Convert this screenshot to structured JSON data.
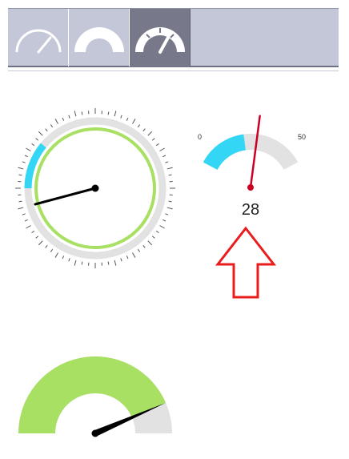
{
  "toolbar": {
    "tabs": [
      {
        "icon": "gauge-outline-icon",
        "selected": false
      },
      {
        "icon": "gauge-semicircle-icon",
        "selected": false
      },
      {
        "icon": "gauge-tachometer-icon",
        "selected": true
      }
    ]
  },
  "colors": {
    "accent_blue": "#33d7f5",
    "progress_green": "#a8e063",
    "track_gray": "#e2e2e2",
    "needle_black": "#000000",
    "needle_red": "#cc0022",
    "annotation_red": "#ea1c1c",
    "toolbar_bg": "#c4c7d8",
    "toolbar_selected": "#77798b"
  },
  "gauges": {
    "circular": {
      "accent_range_fraction": 0.11,
      "progress_fraction": 1.0
    },
    "semicircle": {
      "min_label": "0",
      "max_label": "50",
      "min": 0,
      "max": 50,
      "value": 28,
      "value_label": "28",
      "filled_to": 22
    },
    "half_donut": {
      "filled_fraction": 0.87
    }
  }
}
